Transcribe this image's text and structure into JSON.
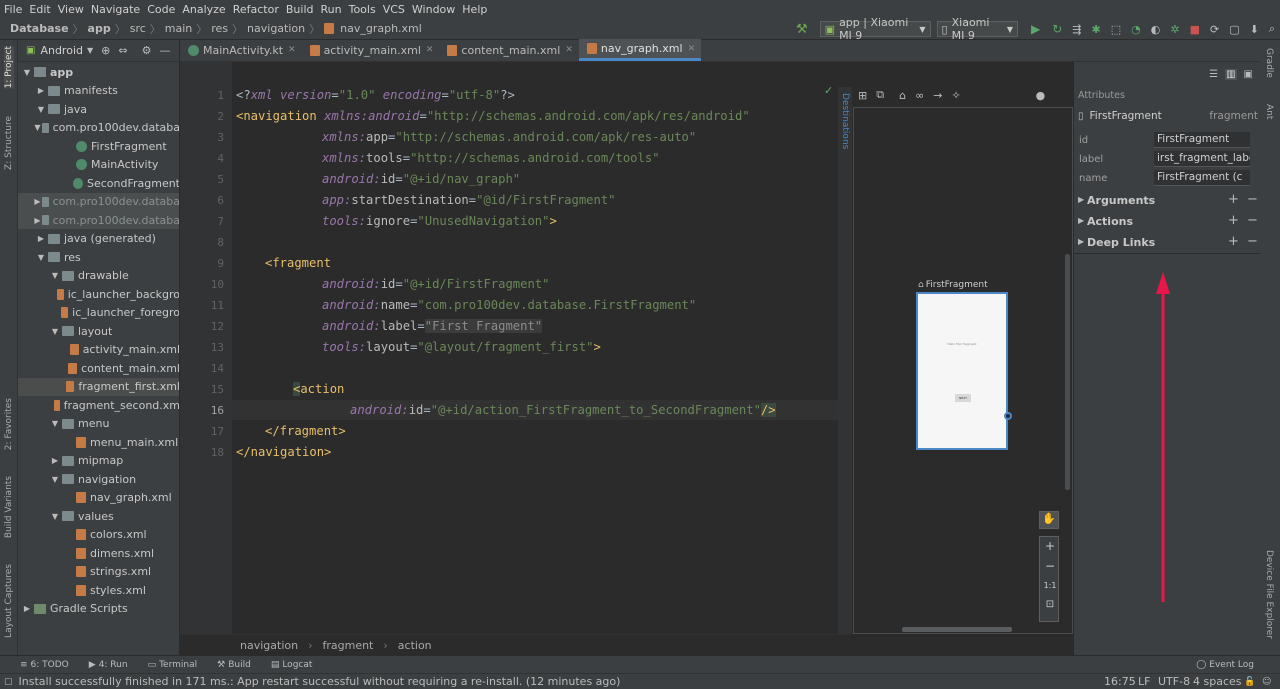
{
  "menu": [
    "File",
    "Edit",
    "View",
    "Navigate",
    "Code",
    "Analyze",
    "Refactor",
    "Build",
    "Run",
    "Tools",
    "VCS",
    "Window",
    "Help"
  ],
  "breadcrumb": [
    "Database",
    "app",
    "src",
    "main",
    "res",
    "navigation",
    "nav_graph.xml"
  ],
  "toolbar": {
    "run_config": "app | Xiaomi MI 9",
    "device": "Xiaomi MI 9"
  },
  "left_tools": [
    "1: Project",
    "Z: Structure",
    "2: Favorites",
    "Build Variants",
    "Layout Captures"
  ],
  "right_tools": [
    "Gradle",
    "Ant",
    "Device File Explorer"
  ],
  "project": {
    "view_selector": "Android",
    "tree": [
      {
        "label": "app",
        "depth": 0,
        "arrow": "▼",
        "icon": "folder",
        "bold": true
      },
      {
        "label": "manifests",
        "depth": 1,
        "arrow": "▶",
        "icon": "folder"
      },
      {
        "label": "java",
        "depth": 1,
        "arrow": "▼",
        "icon": "folder"
      },
      {
        "label": "com.pro100dev.databa",
        "depth": 2,
        "arrow": "▼",
        "icon": "folder"
      },
      {
        "label": "FirstFragment",
        "depth": 3,
        "arrow": "",
        "icon": "class"
      },
      {
        "label": "MainActivity",
        "depth": 3,
        "arrow": "",
        "icon": "class"
      },
      {
        "label": "SecondFragment",
        "depth": 3,
        "arrow": "",
        "icon": "class"
      },
      {
        "label": "com.pro100dev.databa",
        "depth": 2,
        "arrow": "▶",
        "icon": "folder",
        "dim": true
      },
      {
        "label": "com.pro100dev.databa",
        "depth": 2,
        "arrow": "▶",
        "icon": "folder",
        "dim": true
      },
      {
        "label": "java (generated)",
        "depth": 1,
        "arrow": "▶",
        "icon": "folder"
      },
      {
        "label": "res",
        "depth": 1,
        "arrow": "▼",
        "icon": "folder"
      },
      {
        "label": "drawable",
        "depth": 2,
        "arrow": "▼",
        "icon": "folder"
      },
      {
        "label": "ic_launcher_backgro",
        "depth": 3,
        "arrow": "",
        "icon": "xml"
      },
      {
        "label": "ic_launcher_foregro",
        "depth": 3,
        "arrow": "",
        "icon": "xml"
      },
      {
        "label": "layout",
        "depth": 2,
        "arrow": "▼",
        "icon": "folder"
      },
      {
        "label": "activity_main.xml",
        "depth": 3,
        "arrow": "",
        "icon": "xml"
      },
      {
        "label": "content_main.xml",
        "depth": 3,
        "arrow": "",
        "icon": "xml"
      },
      {
        "label": "fragment_first.xml",
        "depth": 3,
        "arrow": "",
        "icon": "xml",
        "selected": true
      },
      {
        "label": "fragment_second.xm",
        "depth": 3,
        "arrow": "",
        "icon": "xml"
      },
      {
        "label": "menu",
        "depth": 2,
        "arrow": "▼",
        "icon": "folder"
      },
      {
        "label": "menu_main.xml",
        "depth": 3,
        "arrow": "",
        "icon": "xml"
      },
      {
        "label": "mipmap",
        "depth": 2,
        "arrow": "▶",
        "icon": "folder"
      },
      {
        "label": "navigation",
        "depth": 2,
        "arrow": "▼",
        "icon": "folder"
      },
      {
        "label": "nav_graph.xml",
        "depth": 3,
        "arrow": "",
        "icon": "xml"
      },
      {
        "label": "values",
        "depth": 2,
        "arrow": "▼",
        "icon": "folder"
      },
      {
        "label": "colors.xml",
        "depth": 3,
        "arrow": "",
        "icon": "xml"
      },
      {
        "label": "dimens.xml",
        "depth": 3,
        "arrow": "",
        "icon": "xml"
      },
      {
        "label": "strings.xml",
        "depth": 3,
        "arrow": "",
        "icon": "xml"
      },
      {
        "label": "styles.xml",
        "depth": 3,
        "arrow": "",
        "icon": "xml"
      },
      {
        "label": "Gradle Scripts",
        "depth": 0,
        "arrow": "▶",
        "icon": "gradle"
      }
    ]
  },
  "tabs": [
    {
      "label": "MainActivity.kt",
      "active": false
    },
    {
      "label": "activity_main.xml",
      "active": false
    },
    {
      "label": "content_main.xml",
      "active": false
    },
    {
      "label": "nav_graph.xml",
      "active": true
    }
  ],
  "code": {
    "line_numbers": [
      "1",
      "2",
      "3",
      "4",
      "5",
      "6",
      "7",
      "8",
      "9",
      "10",
      "11",
      "12",
      "13",
      "14",
      "15",
      "16",
      "17",
      "18"
    ],
    "l1": {
      "a": "<?",
      "b": "xml ",
      "c": "version",
      "d": "=",
      "e": "\"1.0\"",
      "f": " encoding",
      "g": "=",
      "h": "\"utf-8\"",
      "i": "?>"
    },
    "l2": {
      "tag": "<navigation ",
      "ns": "xmlns:",
      "attr": "android",
      "eq": "=",
      "val": "\"http://schemas.android.com/apk/res/android\""
    },
    "l3": {
      "ns": "xmlns:",
      "attr": "app",
      "eq": "=",
      "val": "\"http://schemas.android.com/apk/res-auto\""
    },
    "l4": {
      "ns": "xmlns:",
      "attr": "tools",
      "eq": "=",
      "val": "\"http://schemas.android.com/tools\""
    },
    "l5": {
      "ns": "android:",
      "attr": "id",
      "eq": "=",
      "val": "\"@+id/nav_graph\""
    },
    "l6": {
      "ns": "app:",
      "attr": "startDestination",
      "eq": "=",
      "val": "\"@id/FirstFragment\""
    },
    "l7": {
      "ns": "tools:",
      "attr": "ignore",
      "eq": "=",
      "val": "\"UnusedNavigation\"",
      "end": ">"
    },
    "l9": {
      "tag": "<fragment"
    },
    "l10": {
      "ns": "android:",
      "attr": "id",
      "eq": "=",
      "val": "\"@+id/FirstFragment\""
    },
    "l11": {
      "ns": "android:",
      "attr": "name",
      "eq": "=",
      "val": "\"com.pro100dev.database.FirstFragment\""
    },
    "l12": {
      "ns": "android:",
      "attr": "label",
      "eq": "=",
      "val": "\"First Fragment\""
    },
    "l13": {
      "ns": "tools:",
      "attr": "layout",
      "eq": "=",
      "val": "\"@layout/fragment_first\"",
      "end": ">"
    },
    "l15": {
      "lt": "<",
      "tag": "action"
    },
    "l16": {
      "ns": "android:",
      "attr": "id",
      "eq": "=",
      "val": "\"@+id/action_FirstFragment_to_SecondFragment\"",
      "end": "/>"
    },
    "l17": {
      "tag": "</fragment>"
    },
    "l18": {
      "tag": "</navigation>"
    }
  },
  "editor_breadcrumb": [
    "navigation",
    "fragment",
    "action"
  ],
  "design": {
    "destinations_label": "Destinations",
    "fragment_title": "FirstFragment",
    "phone_text": "Hello first fragment",
    "phone_button": "NEXT",
    "zoom": [
      "+",
      "−",
      "1:1"
    ]
  },
  "attributes": {
    "header": "Attributes",
    "component": "FirstFragment",
    "component_type": "fragment",
    "rows": [
      {
        "label": "id",
        "value": "FirstFragment"
      },
      {
        "label": "label",
        "value": "irst_fragment_label"
      },
      {
        "label": "name",
        "value": "FirstFragment (c"
      }
    ],
    "sections": [
      "Arguments",
      "Actions",
      "Deep Links"
    ],
    "annotation_color": "#e8174a"
  },
  "bottom_tools": [
    "6: TODO",
    "4: Run",
    "Terminal",
    "Build",
    "Logcat",
    "Event Log"
  ],
  "status": {
    "message": "Install successfully finished in 171 ms.: App restart successful without requiring a re-install. (12 minutes ago)",
    "position": "16:75",
    "line_sep": "LF",
    "encoding": "UTF-8",
    "indent": "4 spaces"
  }
}
